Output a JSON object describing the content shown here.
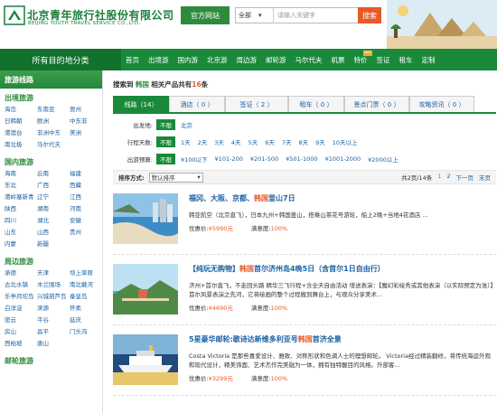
{
  "header": {
    "logo_cn": "北京青年旅行社股份有限公司",
    "logo_en": "BEIJING YOUTH TRAVEL SERVICE CO.,LTD.",
    "official_site": "官方网站",
    "search_scope": "全部",
    "search_placeholder": "请输入关键字",
    "search_button": "搜索"
  },
  "nav": {
    "category_label": "所有目的地分类",
    "items": [
      "首页",
      "出境游",
      "国内游",
      "北京游",
      "周边游",
      "邮轮游",
      "马尔代夫",
      "机票",
      "特价",
      "签证",
      "租车",
      "定制"
    ],
    "hot_badge": "Hot"
  },
  "sidebar": {
    "title": "旅游线路",
    "groups": [
      {
        "title": "出境旅游",
        "links": [
          "海岛",
          "东南亚",
          "贾州",
          "日韩朝",
          "欧洲",
          "中东非",
          "港澳台",
          "非洲中东",
          "美洲",
          "南北极",
          "马尔代夫"
        ]
      },
      {
        "title": "国内旅游",
        "links": [
          "海南",
          "云南",
          "福建",
          "东北",
          "广西",
          "西藏",
          "港岭塞新青",
          "辽宁",
          "江西",
          "陕西",
          "湖南",
          "河南",
          "四川",
          "湖北",
          "安徽",
          "山东",
          "山西",
          "贵州",
          "内蒙",
          "新疆"
        ]
      },
      {
        "title": "周边旅游",
        "links": [
          "承德",
          "天津",
          "坝上草原",
          "古北水镇",
          "木兰围场",
          "南北戴河",
          "乐亭月坨岛",
          "兴城葫芦岛",
          "秦皇岛",
          "白洋淀",
          "涞源",
          "怀柔",
          "密云",
          "平谷",
          "延庆",
          "房山",
          "昌平",
          "门头沟",
          "西柏坡",
          "唐山"
        ]
      },
      {
        "title": "邮轮旅游",
        "links": []
      }
    ]
  },
  "results": {
    "prefix": "搜索到",
    "keyword": "韩国",
    "middle": "相关产品共有",
    "count": "16",
    "suffix": "条"
  },
  "tabs": [
    {
      "label": "线路（14）",
      "active": true
    },
    {
      "label": "酒店（ 0 ）",
      "active": false
    },
    {
      "label": "签证（ 2 ）",
      "active": false
    },
    {
      "label": "租车（ 0 ）",
      "active": false
    },
    {
      "label": "景点门票（ 0 ）",
      "active": false
    },
    {
      "label": "攻略资讯（ 0 ）",
      "active": false
    }
  ],
  "filters": [
    {
      "label": "出发地:",
      "all": "不限",
      "options": [
        "北京"
      ]
    },
    {
      "label": "行程天数:",
      "all": "不限",
      "options": [
        "1天",
        "2天",
        "3天",
        "4天",
        "5天",
        "6天",
        "7天",
        "8天",
        "9天",
        "10天以上"
      ]
    },
    {
      "label": "出游预算:",
      "all": "不限",
      "options": [
        "¥100以下",
        "¥101-200",
        "¥201-500",
        "¥501-1000",
        "¥1001-2000",
        "¥2000以上"
      ]
    }
  ],
  "sort": {
    "label": "排序方式:",
    "value": "默认排序",
    "pager_total": "共2页/14条",
    "pages": [
      "1",
      "2"
    ],
    "next": "下一页",
    "last": "末页"
  },
  "products": [
    {
      "title_pre": "福冈、大阪、京都、",
      "title_hl": "韩国",
      "title_post": "釜山7日",
      "desc": "韩亚航空（北京直飞），日本九州+韩国釜山，搭乘山茶花号游轮，船上2晚+当地4花酒店 ...",
      "price_label": "优惠价:",
      "price": "¥5990元",
      "sat_label": "满意度:",
      "sat": "100%"
    },
    {
      "title_pre": "【纯玩无购物】",
      "title_hl": "韩国",
      "title_post": "首尔济州岛4晚5日（含首尔1日自由行）",
      "desc": "济州+首尔直飞，不走回头路 精华三飞行程+含全天自由活动 增送表演：【魔幻彩绘秀或其他表演（以实际预定为准）】首尔风景表演之先河，它将绘画的整个过程搬到舞台上，与观众分享美术...",
      "price_label": "优惠价:",
      "price": "¥4690元",
      "sat_label": "满意度:",
      "sat": "100%"
    },
    {
      "title_pre": "5星豪华邮轮:歌诗达新维多利亚号",
      "title_hl": "韩国",
      "title_post": "首济全景",
      "desc": "Costa Victoria 是那些喜爱设计、雅致、对称形状和色调人士的理想邮轮。 Victoria经过精装翻修，将传统海运外观和现代设计，精美饰面、艺术杰作完美融为一体，拥有独特醒目的风格。外部客...",
      "price_label": "优惠价:",
      "price": "¥3299元",
      "sat_label": "满意度:",
      "sat": "100%"
    }
  ]
}
